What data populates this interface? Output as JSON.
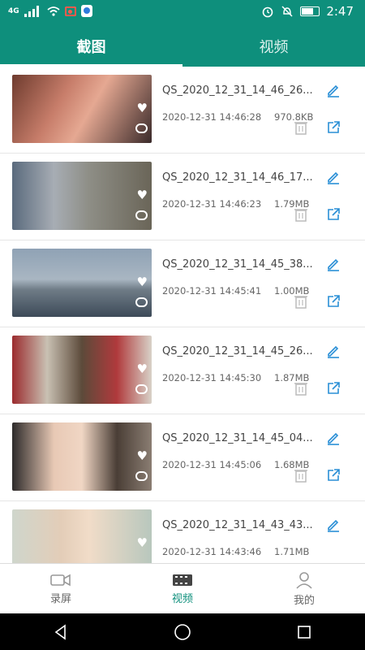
{
  "status": {
    "time": "2:47",
    "net": "4G"
  },
  "tabs": [
    {
      "label": "截图",
      "active": true
    },
    {
      "label": "视频",
      "active": false
    }
  ],
  "items": [
    {
      "name": "QS_2020_12_31_14_46_26...",
      "date": "2020-12-31 14:46:28",
      "size": "970.8KB"
    },
    {
      "name": "QS_2020_12_31_14_46_17...",
      "date": "2020-12-31 14:46:23",
      "size": "1.79MB"
    },
    {
      "name": "QS_2020_12_31_14_45_38...",
      "date": "2020-12-31 14:45:41",
      "size": "1.00MB"
    },
    {
      "name": "QS_2020_12_31_14_45_26...",
      "date": "2020-12-31 14:45:30",
      "size": "1.87MB"
    },
    {
      "name": "QS_2020_12_31_14_45_04...",
      "date": "2020-12-31 14:45:06",
      "size": "1.68MB"
    },
    {
      "name": "QS_2020_12_31_14_43_43...",
      "date": "2020-12-31 14:43:46",
      "size": "1.71MB"
    }
  ],
  "nav": [
    {
      "label": "录屏",
      "icon": "camcorder-icon",
      "active": false
    },
    {
      "label": "视频",
      "icon": "film-icon",
      "active": true
    },
    {
      "label": "我的",
      "icon": "person-icon",
      "active": false
    }
  ],
  "colors": {
    "accent": "#0e8f7c",
    "edit": "#2a8fd6"
  }
}
